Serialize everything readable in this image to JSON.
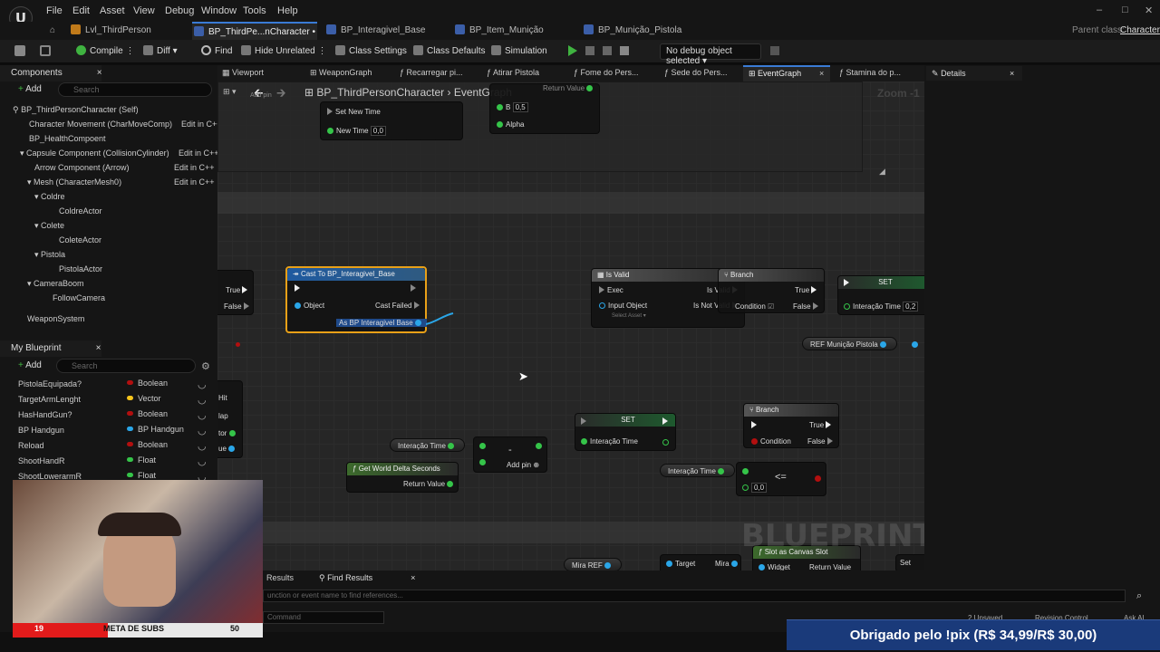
{
  "menu": {
    "items": [
      "File",
      "Edit",
      "Asset",
      "View",
      "Debug",
      "Window",
      "Tools",
      "Help"
    ]
  },
  "window": {
    "minimize": "–",
    "maximize": "□",
    "close": "✕"
  },
  "doc_tabs": {
    "t0": "Lvl_ThirdPerson",
    "t1": "BP_ThirdPe...nCharacter",
    "t2": "BP_Interagivel_Base",
    "t3": "BP_Item_Munição",
    "t4": "BP_Munição_Pistola",
    "parent_label": "Parent class:",
    "parent_value": "Character",
    "modified": "•"
  },
  "toolbar": {
    "compile": "Compile",
    "diff": "Diff",
    "find": "Find",
    "hide_unrelated": "Hide Unrelated",
    "class_settings": "Class Settings",
    "class_defaults": "Class Defaults",
    "simulation": "Simulation",
    "debug_object": "No debug object selected"
  },
  "components": {
    "title": "Components",
    "add": "Add",
    "search_placeholder": "Search",
    "root": "BP_ThirdPersonCharacter (Self)",
    "items": [
      {
        "label": "Character Movement (CharMoveComp)",
        "edit": "Edit in C++"
      },
      {
        "label": "BP_HealthCompoent",
        "edit": ""
      },
      {
        "label": "Capsule Component (CollisionCylinder)",
        "edit": "Edit in C++"
      },
      {
        "label": "Arrow Component (Arrow)",
        "edit": "Edit in C++"
      },
      {
        "label": "Mesh (CharacterMesh0)",
        "edit": "Edit in C++"
      },
      {
        "label": "Coldre",
        "edit": ""
      },
      {
        "label": "ColdreActor",
        "edit": ""
      },
      {
        "label": "Colete",
        "edit": ""
      },
      {
        "label": "ColeteActor",
        "edit": ""
      },
      {
        "label": "Pistola",
        "edit": ""
      },
      {
        "label": "PistolaActor",
        "edit": ""
      },
      {
        "label": "CameraBoom",
        "edit": ""
      },
      {
        "label": "FollowCamera",
        "edit": ""
      },
      {
        "label": "WeaponSystem",
        "edit": ""
      }
    ]
  },
  "my_blueprint": {
    "title": "My Blueprint",
    "add": "Add",
    "search_placeholder": "Search",
    "vars": [
      {
        "name": "PistolaEquipada?",
        "type": "Boolean",
        "color": "#b20f0f"
      },
      {
        "name": "TargetArmLenght",
        "type": "Vector",
        "color": "#f7c51c"
      },
      {
        "name": "HasHandGun?",
        "type": "Boolean",
        "color": "#b20f0f"
      },
      {
        "name": "BP Handgun",
        "type": "BP Handgun",
        "color": "#2aa6e8"
      },
      {
        "name": "Reload",
        "type": "Boolean",
        "color": "#b20f0f"
      },
      {
        "name": "ShootHandR",
        "type": "Float",
        "color": "#35c449"
      },
      {
        "name": "ShootLowerarmR",
        "type": "Float",
        "color": "#35c449"
      }
    ]
  },
  "graph_tabs": {
    "viewport": "Viewport",
    "weapon_graph": "WeaponGraph",
    "recarregar": "Recarregar pi...",
    "atirar": "Atirar Pistola",
    "fome": "Fome do Pers...",
    "sede": "Sede do Pers...",
    "event_graph": "EventGraph",
    "stamina": "Stamina do p..."
  },
  "details": {
    "title": "Details"
  },
  "graph": {
    "breadcrumb_class": "BP_ThirdPersonCharacter",
    "breadcrumb_sep": "›",
    "breadcrumb_graph": "EventGraph",
    "zoom": "Zoom -1",
    "watermark": "BLUEPRINT",
    "top": {
      "set_new_time": "Set New Time",
      "new_time": "New Time",
      "new_time_val": "0,0",
      "return_value": "Return Value",
      "b": "B",
      "b_val": "0,5",
      "alpha": "Alpha",
      "add_pin": "Add pin"
    },
    "left_pins": {
      "true": "True",
      "false": "False",
      "hit": "Hit",
      "lap": "lap",
      "tor": "tor",
      "ue": "ue"
    },
    "cast": {
      "title": "Cast To BP_Interagivel_Base",
      "object": "Object",
      "cast_failed": "Cast Failed",
      "as": "As BP Interagivel Base"
    },
    "isvalid": {
      "title": "Is Valid",
      "exec": "Exec",
      "is_valid": "Is Valid",
      "input_object": "Input Object",
      "select_asset": "Select Asset",
      "is_not_valid": "Is Not Valid"
    },
    "branch1": {
      "title": "Branch",
      "true": "True",
      "condition": "Condition",
      "false": "False"
    },
    "set1": {
      "title": "SET",
      "var": "Interação Time",
      "val": "0,2"
    },
    "ref_municao": "REF Munição Pistola",
    "get_interacao": "Interação Time",
    "subtract": {
      "sym": "-",
      "add_pin": "Add pin"
    },
    "world_delta": {
      "title": "Get World Delta Seconds",
      "return": "Return Value"
    },
    "set2": {
      "title": "SET",
      "var": "Interação Time"
    },
    "branch2": {
      "title": "Branch",
      "true": "True",
      "condition": "Condition",
      "false": "False"
    },
    "get_interacao2": "Interação Time",
    "lte": {
      "sym": "<=",
      "val": "0,0"
    },
    "bottom_nodes": {
      "mira_ref": "Mira REF",
      "target": "Target",
      "mira": "Mira",
      "slot": "Slot as Canvas Slot",
      "widget": "Widget",
      "ret": "Return Value",
      "set": "Set"
    }
  },
  "bottom": {
    "results": "Results",
    "find_results": "Find Results",
    "find_placeholder": "unction or event name to find references...",
    "command": "Command",
    "unsaved": "2 Unsaved",
    "revision": "Revision Control",
    "ask": "Ask AI"
  },
  "stream": {
    "subs_current": "19",
    "subs_label": "META DE SUBS",
    "subs_goal": "50",
    "pix_text": "Obrigado pelo !pix (R$ 34,99/R$ 30,00)"
  }
}
